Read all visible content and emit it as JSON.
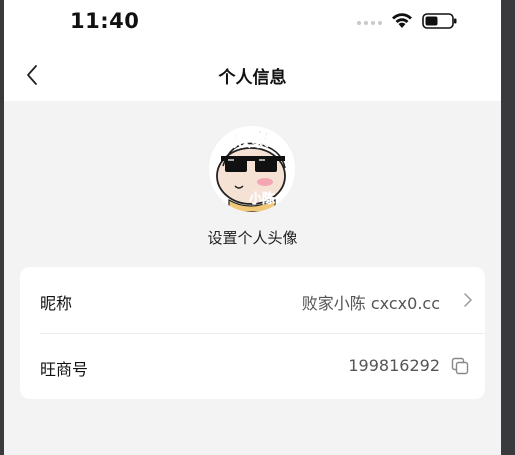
{
  "status_bar": {
    "time": "11:40"
  },
  "nav": {
    "title": "个人信息",
    "back_icon": "chevron-left-icon"
  },
  "avatar": {
    "overlay_text_top": "败家",
    "overlay_text_bottom": "小陈",
    "label": "设置个人头像"
  },
  "profile_rows": [
    {
      "label": "昵称",
      "value": "败家小陈 cxcx0.cc",
      "icon": "chevron-right-icon"
    },
    {
      "label": "旺商号",
      "value": "199816292",
      "icon": "copy-icon"
    }
  ],
  "colors": {
    "background": "#f3f3f3",
    "card": "#ffffff",
    "text_primary": "#111111",
    "text_secondary": "#555555"
  }
}
